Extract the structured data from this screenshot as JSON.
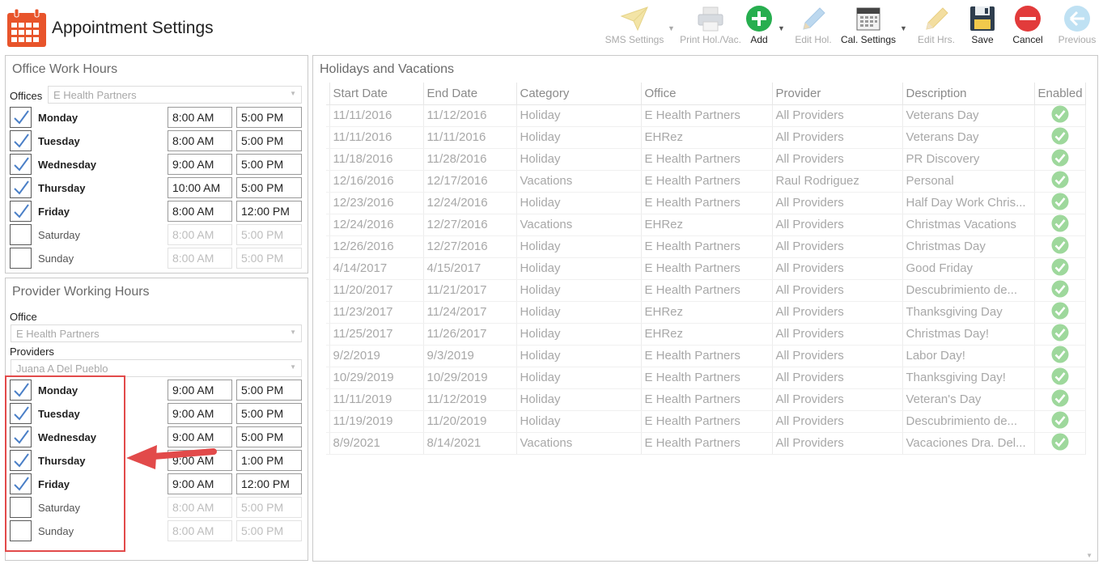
{
  "app": {
    "title": "Appointment Settings",
    "icon": "calendar-icon"
  },
  "toolbar": {
    "buttons": [
      {
        "label": "SMS Settings",
        "icon": "paper-plane-icon",
        "enabled": false
      },
      {
        "label": "Print Hol./Vac.",
        "icon": "printer-icon",
        "enabled": false
      },
      {
        "label": "Add",
        "icon": "plus-circle-icon",
        "enabled": true
      },
      {
        "label": "Edit Hol.",
        "icon": "pencil-icon",
        "enabled": false
      },
      {
        "label": "Cal. Settings",
        "icon": "calendar-settings-icon",
        "enabled": true
      },
      {
        "label": "Edit Hrs.",
        "icon": "pencil-icon",
        "enabled": false
      },
      {
        "label": "Save",
        "icon": "floppy-disk-icon",
        "enabled": true
      },
      {
        "label": "Cancel",
        "icon": "cancel-circle-icon",
        "enabled": true
      },
      {
        "label": "Previous",
        "icon": "arrow-left-circle-icon",
        "enabled": false
      }
    ]
  },
  "office_hours": {
    "title": "Office Work Hours",
    "offices_label": "Offices",
    "office_value": "E Health Partners",
    "days": [
      {
        "name": "Monday",
        "checked": true,
        "start": "8:00 AM",
        "end": "5:00 PM"
      },
      {
        "name": "Tuesday",
        "checked": true,
        "start": "8:00 AM",
        "end": "5:00 PM"
      },
      {
        "name": "Wednesday",
        "checked": true,
        "start": "9:00 AM",
        "end": "5:00 PM"
      },
      {
        "name": "Thursday",
        "checked": true,
        "start": "10:00 AM",
        "end": "5:00 PM"
      },
      {
        "name": "Friday",
        "checked": true,
        "start": "8:00 AM",
        "end": "12:00 PM"
      },
      {
        "name": "Saturday",
        "checked": false,
        "start": "8:00 AM",
        "end": "5:00 PM"
      },
      {
        "name": "Sunday",
        "checked": false,
        "start": "8:00 AM",
        "end": "5:00 PM"
      }
    ]
  },
  "provider_hours": {
    "title": "Provider Working Hours",
    "office_label": "Office",
    "office_value": "E Health Partners",
    "providers_label": "Providers",
    "provider_value": "Juana A Del Pueblo",
    "days": [
      {
        "name": "Monday",
        "checked": true,
        "start": "9:00 AM",
        "end": "5:00 PM"
      },
      {
        "name": "Tuesday",
        "checked": true,
        "start": "9:00 AM",
        "end": "5:00 PM"
      },
      {
        "name": "Wednesday",
        "checked": true,
        "start": "9:00 AM",
        "end": "5:00 PM"
      },
      {
        "name": "Thursday",
        "checked": true,
        "start": "9:00 AM",
        "end": "1:00 PM"
      },
      {
        "name": "Friday",
        "checked": true,
        "start": "9:00 AM",
        "end": "12:00 PM"
      },
      {
        "name": "Saturday",
        "checked": false,
        "start": "8:00 AM",
        "end": "5:00 PM"
      },
      {
        "name": "Sunday",
        "checked": false,
        "start": "8:00 AM",
        "end": "5:00 PM"
      }
    ]
  },
  "holidays": {
    "title": "Holidays and Vacations",
    "columns": [
      "Start Date",
      "End Date",
      "Category",
      "Office",
      "Provider",
      "Description",
      "Enabled"
    ],
    "rows": [
      [
        "11/11/2016",
        "11/12/2016",
        "Holiday",
        "E Health Partners",
        "All Providers",
        "Veterans Day"
      ],
      [
        "11/11/2016",
        "11/11/2016",
        "Holiday",
        "EHRez",
        "All Providers",
        "Veterans Day"
      ],
      [
        "11/18/2016",
        "11/28/2016",
        "Holiday",
        "E Health Partners",
        "All Providers",
        "PR Discovery"
      ],
      [
        "12/16/2016",
        "12/17/2016",
        "Vacations",
        "E Health Partners",
        "Raul Rodriguez",
        "Personal"
      ],
      [
        "12/23/2016",
        "12/24/2016",
        "Holiday",
        "E Health Partners",
        "All Providers",
        "Half Day Work Chris..."
      ],
      [
        "12/24/2016",
        "12/27/2016",
        "Vacations",
        "EHRez",
        "All Providers",
        "Christmas Vacations"
      ],
      [
        "12/26/2016",
        "12/27/2016",
        "Holiday",
        "E Health Partners",
        "All Providers",
        "Christmas Day"
      ],
      [
        "4/14/2017",
        "4/15/2017",
        "Holiday",
        "E Health Partners",
        "All Providers",
        "Good Friday"
      ],
      [
        "11/20/2017",
        "11/21/2017",
        "Holiday",
        "E Health Partners",
        "All Providers",
        "Descubrimiento de..."
      ],
      [
        "11/23/2017",
        "11/24/2017",
        "Holiday",
        "EHRez",
        "All Providers",
        "Thanksgiving Day"
      ],
      [
        "11/25/2017",
        "11/26/2017",
        "Holiday",
        "EHRez",
        "All Providers",
        "Christmas Day!"
      ],
      [
        "9/2/2019",
        "9/3/2019",
        "Holiday",
        "E Health Partners",
        "All Providers",
        "Labor Day!"
      ],
      [
        "10/29/2019",
        "10/29/2019",
        "Holiday",
        "E Health Partners",
        "All Providers",
        "Thanksgiving Day!"
      ],
      [
        "11/11/2019",
        "11/12/2019",
        "Holiday",
        "E Health Partners",
        "All Providers",
        "Veteran's Day"
      ],
      [
        "11/19/2019",
        "11/20/2019",
        "Holiday",
        "E Health Partners",
        "All Providers",
        "Descubrimiento de..."
      ],
      [
        "8/9/2021",
        "8/14/2021",
        "Vacations",
        "E Health Partners",
        "All Providers",
        "Vacaciones Dra. Del..."
      ]
    ]
  },
  "colors": {
    "accent_orange": "#e8542b",
    "enabled_check": "#9ed89c",
    "highlight_red": "#e24a4a"
  }
}
